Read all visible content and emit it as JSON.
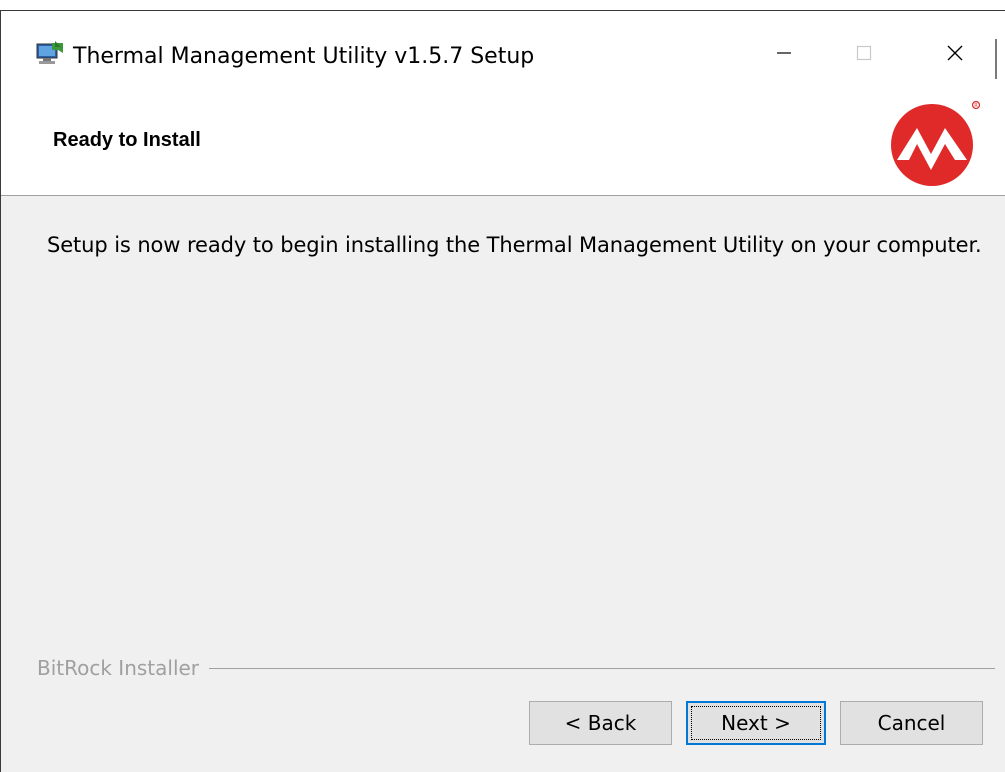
{
  "window": {
    "title": "Thermal Management Utility v1.5.7 Setup",
    "icon": "installer-computer-icon",
    "controls": [
      "minimize-icon",
      "maximize-icon",
      "close-icon"
    ]
  },
  "header": {
    "title": "Ready to Install",
    "logo": "microchip-logo",
    "logo_color": "#e02a2a"
  },
  "body": {
    "message": "Setup is now ready to begin installing the Thermal Management Utility on your computer."
  },
  "footer": {
    "group_label": "BitRock Installer",
    "back_label": "< Back",
    "next_label": "Next >",
    "cancel_label": "Cancel"
  }
}
